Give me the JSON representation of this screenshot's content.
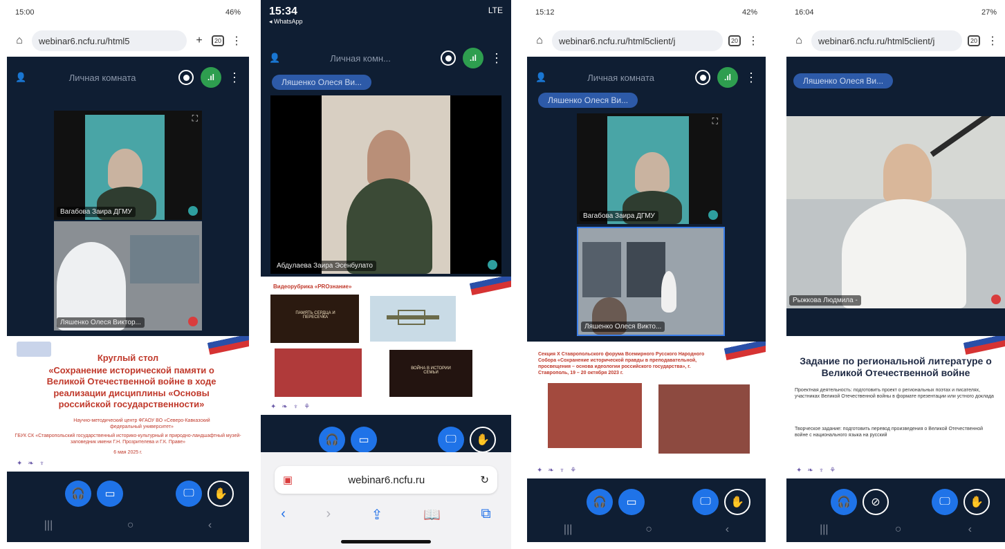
{
  "phone1": {
    "status_time": "15:00",
    "status_battery": "46%",
    "url": "webinar6.ncfu.ru/html5",
    "tabs_count": "20",
    "room_name": "Личная комната",
    "video1_label": "Вагабова Заира ДГМУ",
    "video2_label": "Ляшенко Олеся Виктор...",
    "slide_title": "Круглый стол",
    "slide_heading": "«Сохранение исторической памяти о Великой Отечественной войне в ходе реализации дисциплины «Основы российской государственности»",
    "slide_org1": "Научно-методический центр ФГАОУ ВО «Северо-Кавказский федеральный университет»",
    "slide_org2": "ГБУК СК «Ставропольский государственный историко-культурный и природно-ландшафтный музей-заповедник имени Г.Н. Прозрителева и Г.К. Праве»",
    "slide_date": "6 мая 2025 г."
  },
  "phone2": {
    "status_time": "15:34",
    "status_back": "◂ WhatsApp",
    "status_network": "LTE",
    "room_name": "Личная комн...",
    "presenter_pill": "Ляшенко Олеся Ви...",
    "video_label": "Абдулаева Заира Эсенбулато",
    "slide_title": "Видеорубрика «PROзнание»",
    "thumb1": "ПАМЯТЬ СЕРДЦА И ПЕРЕСЕЧКА",
    "thumb2": "ВОЙНА В ИСТОРИИ СЕМЬИ",
    "safari_url": "webinar6.ncfu.ru"
  },
  "phone3": {
    "status_time": "15:12",
    "status_battery": "42%",
    "url": "webinar6.ncfu.ru/html5client/j",
    "tabs_count": "20",
    "room_name": "Личная комната",
    "presenter_pill": "Ляшенко Олеся Ви...",
    "video1_label": "Вагабова Заира ДГМУ",
    "video2_label": "Ляшенко Олеся Викто...",
    "slide_heading": "Секция X Ставропольского форума Всемирного Русского Народного Собора «Сохранение исторической правды в преподавательной, просвещения – основа идеологии российского государства», г. Ставрополь, 19 – 20 октября 2023 г."
  },
  "phone4": {
    "status_time": "16:04",
    "status_battery": "27%",
    "url": "webinar6.ncfu.ru/html5client/j",
    "tabs_count": "20",
    "presenter_pill": "Ляшенко Олеся Ви...",
    "video_label": "Рыжкова Людмила -",
    "slide_heading": "Задание по региональной литературе о Великой Отечественной войне",
    "slide_p1": "Проектная деятельность: подготовить проект о региональных поэтах и писателях, участниках Великой Отечественной войны в формате презентации или устного доклада",
    "slide_p2": "Творческое задание: подготовить перевод произведения о Великой Отечественной войне с национального языка на русский"
  }
}
